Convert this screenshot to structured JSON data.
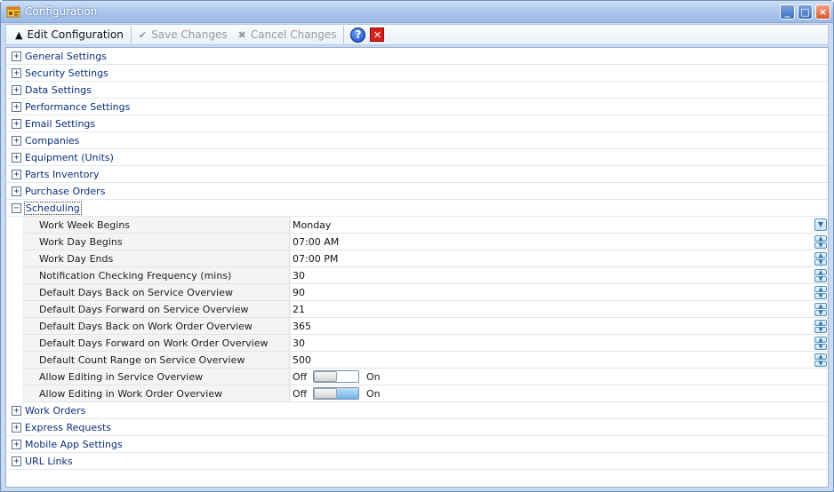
{
  "window": {
    "title": "Configuration",
    "controls": {
      "minimize": "_",
      "maximize": "□",
      "close": "×"
    }
  },
  "toolbar": {
    "edit_label": "Edit Configuration",
    "save_label": "Save Changes",
    "cancel_label": "Cancel Changes",
    "help_icon": "question-icon",
    "delete_icon": "red-x-icon"
  },
  "categories_top": [
    {
      "label": "General Settings",
      "expanded": false
    },
    {
      "label": "Security Settings",
      "expanded": false
    },
    {
      "label": "Data Settings",
      "expanded": false
    },
    {
      "label": "Performance Settings",
      "expanded": false
    },
    {
      "label": "Email Settings",
      "expanded": false
    },
    {
      "label": "Companies",
      "expanded": false
    },
    {
      "label": "Equipment (Units)",
      "expanded": false
    },
    {
      "label": "Parts Inventory",
      "expanded": false
    },
    {
      "label": "Purchase Orders",
      "expanded": false
    }
  ],
  "scheduling": {
    "label": "Scheduling",
    "expanded": true,
    "properties": [
      {
        "name": "Work Week Begins",
        "value": "Monday",
        "editor": "dropdown"
      },
      {
        "name": "Work Day Begins",
        "value": "07:00 AM",
        "editor": "spin"
      },
      {
        "name": "Work Day Ends",
        "value": "07:00 PM",
        "editor": "spin"
      },
      {
        "name": "Notification Checking Frequency (mins)",
        "value": "30",
        "editor": "spin"
      },
      {
        "name": "Default Days Back on Service Overview",
        "value": "90",
        "editor": "spin"
      },
      {
        "name": "Default Days Forward on Service Overview",
        "value": "21",
        "editor": "spin"
      },
      {
        "name": "Default Days Back on Work Order Overview",
        "value": "365",
        "editor": "spin"
      },
      {
        "name": "Default Days Forward on Work Order Overview",
        "value": "30",
        "editor": "spin"
      },
      {
        "name": "Default Count Range on Service Overview",
        "value": "500",
        "editor": "spin"
      }
    ],
    "toggles": [
      {
        "name": "Allow Editing in Service Overview",
        "off_label": "Off",
        "on_label": "On",
        "state": "off"
      },
      {
        "name": "Allow Editing in Work Order Overview",
        "off_label": "Off",
        "on_label": "On",
        "state": "on"
      }
    ]
  },
  "categories_bottom": [
    {
      "label": "Work Orders",
      "expanded": false
    },
    {
      "label": "Express Requests",
      "expanded": false
    },
    {
      "label": "Mobile App Settings",
      "expanded": false
    },
    {
      "label": "URL Links",
      "expanded": false
    }
  ],
  "colors": {
    "category_text": "#0a2e7a",
    "toggle_fill": "#6bb4ea",
    "titlebar": "#a9c4ea"
  }
}
